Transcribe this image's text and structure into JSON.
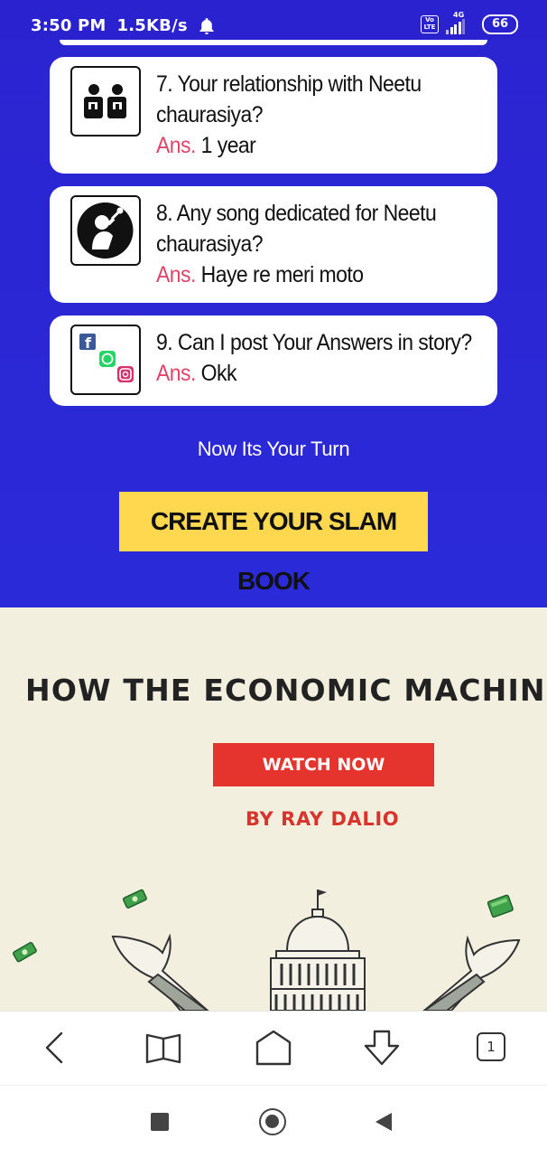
{
  "status_bar": {
    "time": "3:50 PM",
    "speed": "1.5KB/s",
    "notification_icon": "bell-icon",
    "volte_top": "Vo",
    "volte_bottom": "LTE",
    "network": "4G",
    "battery": "66"
  },
  "questions": [
    {
      "number_text": "7. Your relationship with Neetu chaurasiya?",
      "ans_label": "Ans.",
      "answer": "1 year",
      "icon": "friends-icon"
    },
    {
      "number_text": "8. Any song dedicated for Neetu chaurasiya?",
      "ans_label": "Ans.",
      "answer": "Haye re meri moto",
      "icon": "singer-icon"
    },
    {
      "number_text": "9. Can I post Your Answers in story?",
      "ans_label": "Ans.",
      "answer": "Okk",
      "icon": "social-media-icon"
    }
  ],
  "turn_text": "Now Its Your Turn",
  "create_button": "CREATE YOUR SLAM BOOK",
  "ad": {
    "headline": "HOW THE ECONOMIC MACHINE W",
    "watch_button": "WATCH NOW",
    "byline": "BY RAY DALIO"
  },
  "browser_nav": {
    "back": "back-icon",
    "bookmarks": "book-icon",
    "home": "home-icon",
    "download": "download-icon",
    "tabs_count": "1"
  },
  "system_nav": {
    "recents": "square-icon",
    "home": "circle-icon",
    "back": "triangle-back-icon"
  }
}
